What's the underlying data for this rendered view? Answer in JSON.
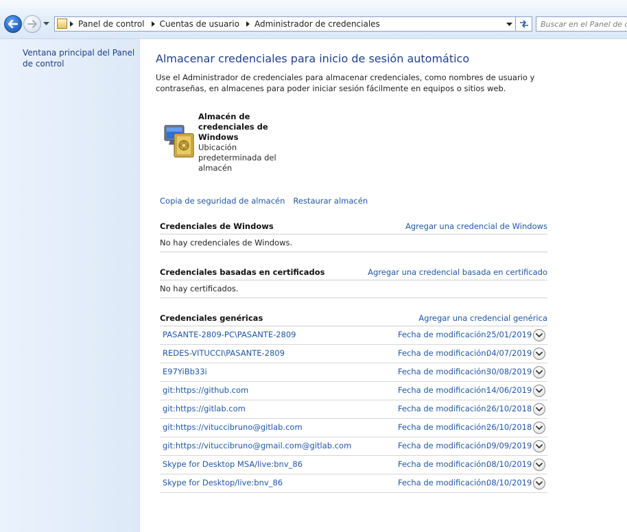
{
  "breadcrumb": [
    "Panel de control",
    "Cuentas de usuario",
    "Administrador de credenciales"
  ],
  "search": {
    "placeholder": "Buscar en el Panel de c"
  },
  "sidebar": {
    "home_link": "Ventana principal del Panel de control"
  },
  "main": {
    "title": "Almacenar credenciales para inicio de sesión automático",
    "description": "Use el Administrador de credenciales para almacenar credenciales, como nombres de usuario y contraseñas, en almacenes para poder iniciar sesión fácilmente en equipos o sitios web.",
    "vault": {
      "name": "Almacén de credenciales de Windows",
      "description": "Ubicación predeterminada del almacén"
    },
    "backup_link": "Copia de seguridad de almacén",
    "restore_link": "Restaurar almacén"
  },
  "sections": {
    "windows": {
      "title": "Credenciales de Windows",
      "add_label": "Agregar una credencial de Windows",
      "empty": "No hay credenciales de Windows."
    },
    "certificate": {
      "title": "Credenciales basadas en certificados",
      "add_label": "Agregar una credencial basada en certificado",
      "empty": "No hay certificados."
    },
    "generic": {
      "title": "Credenciales genéricas",
      "add_label": "Agregar una credencial genérica",
      "modified_label": "Fecha de modificación:",
      "items": [
        {
          "name": "PASANTE-2809-PC\\PASANTE-2809",
          "date": "25/01/2019"
        },
        {
          "name": "REDES-VITUCCI\\PASANTE-2809",
          "date": "04/07/2019"
        },
        {
          "name": "E97YiBb33i",
          "date": "30/08/2019"
        },
        {
          "name": "git:https://github.com",
          "date": "14/06/2019"
        },
        {
          "name": "git:https://gitlab.com",
          "date": "26/10/2018"
        },
        {
          "name": "git:https://vituccibruno@gitlab.com",
          "date": "26/10/2018"
        },
        {
          "name": "git:https://vituccibruno@gmail.com@gitlab.com",
          "date": "09/09/2019"
        },
        {
          "name": "Skype for Desktop MSA/live:bnv_86",
          "date": "08/10/2019"
        },
        {
          "name": "Skype for Desktop/live:bnv_86",
          "date": "08/10/2019"
        }
      ]
    }
  },
  "icons": {
    "back": "back-arrow-icon",
    "forward": "forward-arrow-icon",
    "refresh": "refresh-icon",
    "vault": "credential-vault-icon",
    "expand": "chevron-down-icon"
  }
}
